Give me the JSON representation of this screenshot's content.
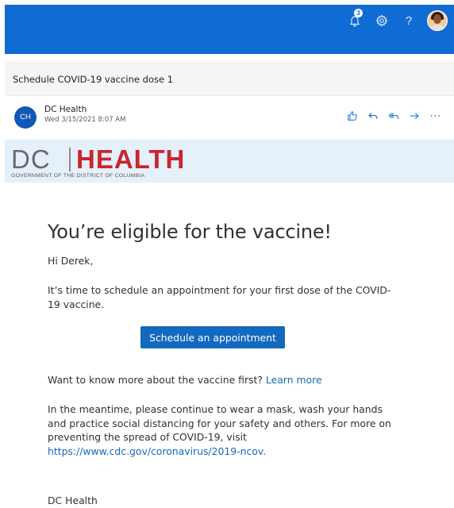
{
  "topbar": {
    "notification_count": "3",
    "icons": [
      "bell-icon",
      "gear-icon",
      "help-icon",
      "avatar"
    ],
    "help_glyph": "?"
  },
  "email": {
    "subject": "Schedule COVID-19 vaccine dose 1",
    "sender_initials": "CH",
    "sender_name": "DC Health",
    "sent_date": "Wed 3/15/2021 8:07 AM",
    "actions": [
      "like-icon",
      "reply-icon",
      "reply-all-icon",
      "forward-icon",
      "more-icon"
    ],
    "more_glyph": "···"
  },
  "banner": {
    "logo_left": "DC",
    "logo_right": "HEALTH",
    "logo_subtitle": "GOVERNMENT OF THE DISTRICT OF COLUMBIA"
  },
  "content": {
    "headline": "You’re eligible for the vaccine!",
    "greeting": "Hi Derek,",
    "paragraph1": "It’s time to schedule an appointment for your first dose of the COVID-19 vaccine.",
    "cta_label": "Schedule an appointment",
    "more_question": "Want to know more about the vaccine first?",
    "more_link": "Learn more",
    "paragraph2_text": "In the meantime, please continue to wear a mask, wash your hands and practice social distancing for your safety and others. For more on preventing the spread of COVID-19, visit",
    "paragraph2_link": "https://www.cdc.gov/coronavirus/2019-ncov.",
    "signature": "DC Health"
  },
  "colors": {
    "topbar": "#0f6cd4",
    "banner": "#e5f0fb",
    "accent": "#1369bf",
    "logo_red": "#c8262d"
  }
}
